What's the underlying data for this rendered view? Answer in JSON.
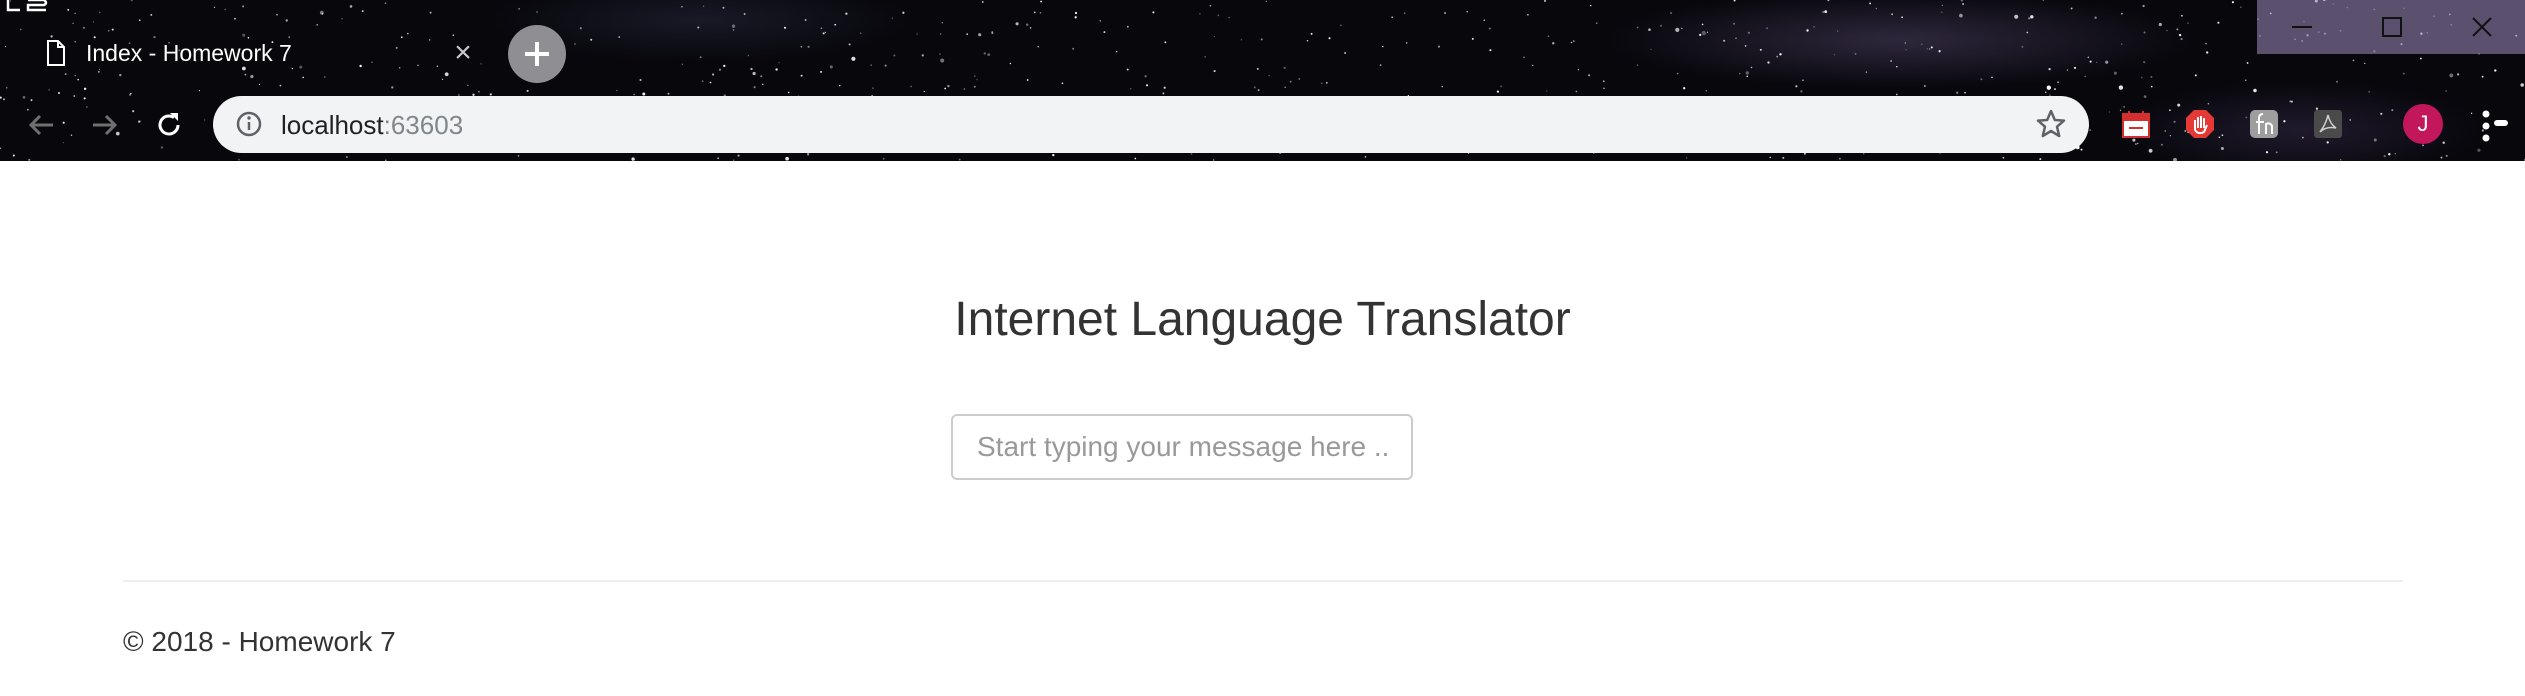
{
  "browser": {
    "tab": {
      "title": "Index - Homework 7"
    },
    "address_bar": {
      "host": "localhost",
      "port": ":63603"
    },
    "profile_initial": "J"
  },
  "page": {
    "heading": "Internet Language Translator",
    "message_input": {
      "placeholder": "Start typing your message here ..",
      "value": ""
    },
    "footer": {
      "copyright": "© 2018 - Homework 7"
    }
  },
  "colors": {
    "avatar": "#c2185b",
    "omnibox_bg": "#f1f3f4",
    "text": "#333333"
  },
  "icons": [
    "page-icon",
    "close-icon",
    "plus-icon",
    "minimize-icon",
    "maximize-icon",
    "window-close-icon",
    "back-arrow-icon",
    "forward-arrow-icon",
    "reload-icon",
    "info-icon",
    "star-icon",
    "extension-icons",
    "menu-icon"
  ]
}
